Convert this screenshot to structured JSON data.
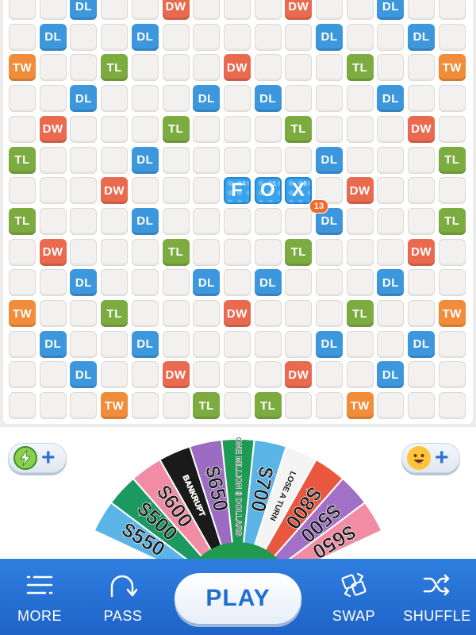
{
  "board": {
    "played_word": {
      "letters": [
        {
          "letter": "F",
          "points": "4"
        },
        {
          "letter": "O",
          "points": "1"
        },
        {
          "letter": "X",
          "points": "8"
        }
      ],
      "score": "13"
    },
    "bonus_rows": [
      [
        ".",
        ".",
        "DL",
        ".",
        ".",
        "DW",
        ".",
        ".",
        ".",
        "DW",
        ".",
        ".",
        "DL",
        ".",
        "."
      ],
      [
        ".",
        "DL",
        ".",
        ".",
        "DL",
        ".",
        ".",
        ".",
        ".",
        ".",
        "DL",
        ".",
        ".",
        "DL",
        "."
      ],
      [
        "TW",
        ".",
        ".",
        "TL",
        ".",
        ".",
        ".",
        "DW",
        ".",
        ".",
        ".",
        "TL",
        ".",
        ".",
        "TW"
      ],
      [
        ".",
        ".",
        "DL",
        ".",
        ".",
        ".",
        "DL",
        ".",
        "DL",
        ".",
        ".",
        ".",
        "DL",
        ".",
        "."
      ],
      [
        ".",
        "DW",
        ".",
        ".",
        ".",
        "TL",
        ".",
        ".",
        ".",
        "TL",
        ".",
        ".",
        ".",
        "DW",
        "."
      ],
      [
        "TL",
        ".",
        ".",
        ".",
        "DL",
        ".",
        ".",
        ".",
        ".",
        ".",
        "DL",
        ".",
        ".",
        ".",
        "TL"
      ],
      [
        ".",
        ".",
        ".",
        "DW",
        ".",
        ".",
        ".",
        ".",
        ".",
        ".",
        ".",
        "DW",
        ".",
        ".",
        "."
      ],
      [
        "TL",
        ".",
        ".",
        ".",
        "DL",
        ".",
        ".",
        ".",
        ".",
        ".",
        "DL",
        ".",
        ".",
        ".",
        "TL"
      ],
      [
        ".",
        "DW",
        ".",
        ".",
        ".",
        "TL",
        ".",
        ".",
        ".",
        "TL",
        ".",
        ".",
        ".",
        "DW",
        "."
      ],
      [
        ".",
        ".",
        "DL",
        ".",
        ".",
        ".",
        "DL",
        ".",
        "DL",
        ".",
        ".",
        ".",
        "DL",
        ".",
        "."
      ],
      [
        "TW",
        ".",
        ".",
        "TL",
        ".",
        ".",
        ".",
        "DW",
        ".",
        ".",
        ".",
        "TL",
        ".",
        ".",
        "TW"
      ],
      [
        ".",
        "DL",
        ".",
        ".",
        "DL",
        ".",
        ".",
        ".",
        ".",
        ".",
        "DL",
        ".",
        ".",
        "DL",
        "."
      ],
      [
        ".",
        ".",
        "DL",
        ".",
        ".",
        "DW",
        ".",
        ".",
        ".",
        "DW",
        ".",
        ".",
        "DL",
        ".",
        "."
      ],
      [
        ".",
        ".",
        ".",
        "TW",
        ".",
        ".",
        "TL",
        ".",
        "TL",
        ".",
        ".",
        "TW",
        ".",
        ".",
        "."
      ]
    ],
    "colors": {
      "DL": "#3d97dc",
      "TL": "#7cab40",
      "DW": "#e96a4e",
      "TW": "#f08c3a",
      "tile": "#3ba3ea"
    }
  },
  "wheel": {
    "slices": [
      {
        "label": "$550",
        "color": "#5ab4e6"
      },
      {
        "label": "$500",
        "color": "#1b9960"
      },
      {
        "label": "$600",
        "color": "#f28ba4"
      },
      {
        "label": "BANKRUPT",
        "color": "#1a1a1a"
      },
      {
        "label": "$650",
        "color": "#9b6cc1"
      },
      {
        "label": "ONE MILLION $ DOLLARS",
        "color": "#1f9a55"
      },
      {
        "label": "$700",
        "color": "#5ab4e6"
      },
      {
        "label": "LOSE A TURN",
        "color": "#f4f4f4"
      },
      {
        "label": "$800",
        "color": "#e9573f"
      },
      {
        "label": "$500",
        "color": "#a370c7"
      },
      {
        "label": "$650",
        "color": "#f28ba4"
      }
    ],
    "hub_color": "#1f9a4f"
  },
  "actions": {
    "boost_icon": "lightning-bolt-icon",
    "emoji_icon": "smiley-face-icon",
    "more": "MORE",
    "pass": "PASS",
    "play": "PLAY",
    "swap": "SWAP",
    "shuffle": "SHUFFLE"
  }
}
